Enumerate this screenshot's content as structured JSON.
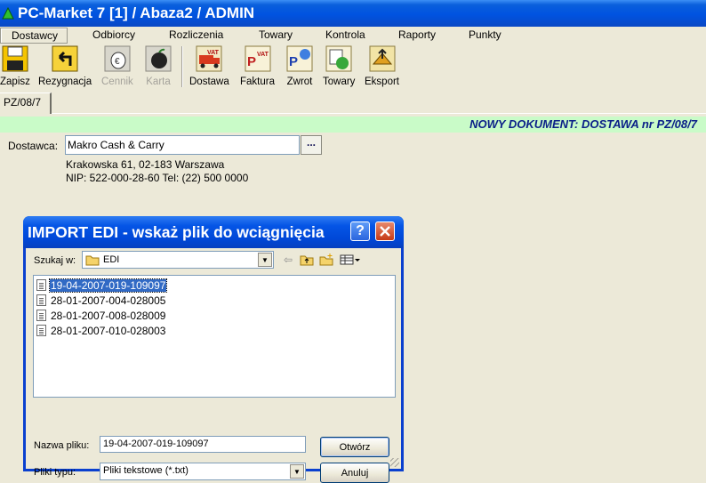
{
  "window": {
    "title": "PC-Market 7 [1] / Abaza2 / ADMIN"
  },
  "menu": [
    {
      "label": "Dostawcy",
      "active": true
    },
    {
      "label": "Odbiorcy"
    },
    {
      "label": "Rozliczenia"
    },
    {
      "label": "Towary"
    },
    {
      "label": "Kontrola"
    },
    {
      "label": "Raporty"
    },
    {
      "label": "Punkty"
    }
  ],
  "toolbar": [
    {
      "label": "Zapisz",
      "icon": "floppy-disk-icon",
      "enabled": true
    },
    {
      "label": "Rezygnacja",
      "icon": "undo-arrow-icon",
      "enabled": true
    },
    {
      "label": "Cennik",
      "icon": "price-tag-icon",
      "enabled": false
    },
    {
      "label": "Karta",
      "icon": "card-icon",
      "enabled": false
    },
    {
      "label": "Dostawa",
      "icon": "delivery-truck-vat-icon",
      "enabled": true
    },
    {
      "label": "Faktura",
      "icon": "invoice-vat-icon",
      "enabled": true
    },
    {
      "label": "Zwrot",
      "icon": "return-icon",
      "enabled": true
    },
    {
      "label": "Towary",
      "icon": "goods-icon",
      "enabled": true
    },
    {
      "label": "Eksport",
      "icon": "export-icon",
      "enabled": true
    }
  ],
  "doc_tab": "PZ/08/7",
  "banner": "NOWY DOKUMENT: DOSTAWA nr PZ/08/7",
  "supplier": {
    "label": "Dostawca:",
    "value": "Makro Cash & Carry",
    "browse": "...",
    "address": "Krakowska 61, 02-183 Warszawa",
    "details": "NIP: 522-000-28-60 Tel: (22) 500 0000"
  },
  "dialog": {
    "title": "IMPORT EDI - wskaż plik do wciągnięcia",
    "help": "?",
    "look_in_label": "Szukaj w:",
    "look_in_value": "EDI",
    "files": [
      {
        "name": "19-04-2007-019-109097",
        "selected": true
      },
      {
        "name": "28-01-2007-004-028005"
      },
      {
        "name": "28-01-2007-008-028009"
      },
      {
        "name": "28-01-2007-010-028003"
      }
    ],
    "filename_label": "Nazwa pliku:",
    "filename_value": "19-04-2007-019-109097",
    "filetype_label": "Pliki typu:",
    "filetype_value": "Pliki tekstowe (*.txt)",
    "open_button": "Otwórz",
    "cancel_button": "Anuluj"
  },
  "colors": {
    "titlebar": "#0053e0",
    "banner_bg": "#c9fbc8",
    "banner_text": "#0a1f88",
    "selection": "#316ac5"
  }
}
